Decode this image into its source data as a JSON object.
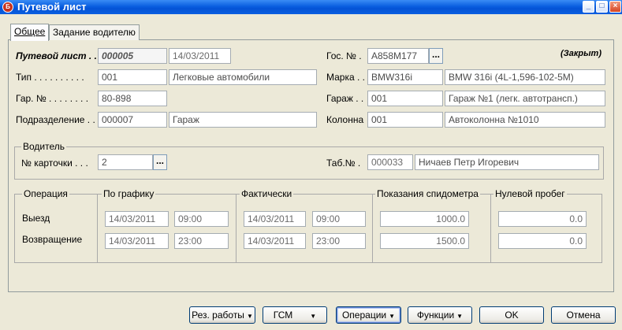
{
  "window": {
    "title": "Путевой лист",
    "icon_letter": "Б",
    "controls": {
      "minimize": "_",
      "maximize": "□",
      "close": "×"
    }
  },
  "tabs": [
    {
      "label": "Общее",
      "active": true
    },
    {
      "label": "Задание водителю",
      "active": false
    }
  ],
  "status": "(Закрыт)",
  "waybill": {
    "label": "Путевой лист . .",
    "number": "000005",
    "date": "14/03/2011"
  },
  "type": {
    "label": "Тип . . . . . . . . . .",
    "code": "001",
    "name": "Легковые автомобили"
  },
  "garage_no": {
    "label": "Гар. № . . . . . . . .",
    "value": "80-898"
  },
  "division": {
    "label": "Подразделение . .",
    "code": "000007",
    "name": "Гараж"
  },
  "plate": {
    "label": "Гос. № .",
    "value": "А858М177",
    "browse": "..."
  },
  "brand": {
    "label": "Марка . .",
    "code": "BMW316i",
    "name": "BMW 316i (4L-1,596-102-5M)"
  },
  "garage": {
    "label": "Гараж . .",
    "code": "001",
    "name": "Гараж №1 (легк. автотрансп.)"
  },
  "column": {
    "label": "Колонна",
    "code": "001",
    "name": "Автоколонна №1010"
  },
  "driver": {
    "group_label": "Водитель",
    "card_label": "№ карточки . . .",
    "card_value": "2",
    "browse": "...",
    "tab_label": "Таб.№ .",
    "tab_value": "000033",
    "name": "Ничаев Петр Игоревич"
  },
  "operations": {
    "headers": {
      "operation": "Операция",
      "scheduled": "По графику",
      "actual": "Фактически",
      "odometer": "Показания спидометра",
      "zero_run": "Нулевой пробег"
    },
    "rows": [
      {
        "label": "Выезд",
        "sched_date": "14/03/2011",
        "sched_time": "09:00",
        "act_date": "14/03/2011",
        "act_time": "09:00",
        "odometer": "1000.0",
        "zero_run": "0.0"
      },
      {
        "label": "Возвращение",
        "sched_date": "14/03/2011",
        "sched_time": "23:00",
        "act_date": "14/03/2011",
        "act_time": "23:00",
        "odometer": "1500.0",
        "zero_run": "0.0"
      }
    ]
  },
  "buttons": {
    "results": "Рез. работы",
    "fuel": "ГСМ",
    "operations": "Операции",
    "functions": "Функции",
    "ok": "OK",
    "cancel": "Отмена"
  }
}
